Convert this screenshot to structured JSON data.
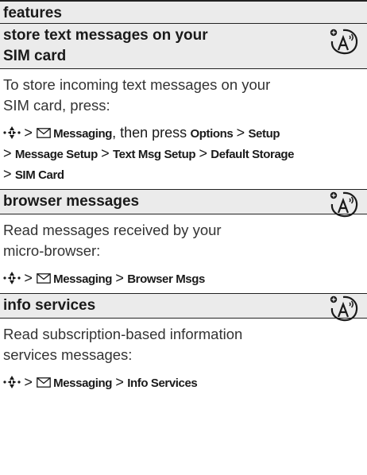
{
  "header": {
    "title": "features"
  },
  "sections": [
    {
      "title_line1": "store text messages on your",
      "title_line2": "SIM card",
      "icon": "network-operator-icon",
      "description_line1": "To store incoming text messages on your",
      "description_line2": "SIM card, press:",
      "path": {
        "messaging": "Messaging",
        "then_press": ", then press",
        "options": "Options",
        "setup": "Setup",
        "message_setup": "Message Setup",
        "text_msg_setup": "Text Msg Setup",
        "default_storage": "Default Storage",
        "sim_card": "SIM Card"
      }
    },
    {
      "title": "browser messages",
      "icon": "network-operator-icon",
      "description_line1": "Read messages received by your",
      "description_line2": "micro-browser:",
      "path": {
        "messaging": "Messaging",
        "browser_msgs": "Browser Msgs"
      }
    },
    {
      "title": "info services",
      "icon": "network-operator-icon",
      "description_line1": "Read subscription-based information",
      "description_line2": "services messages:",
      "path": {
        "messaging": "Messaging",
        "info_services": "Info Services"
      }
    }
  ],
  "separator": ">",
  "icons": {
    "nav_key": "nav-key-icon",
    "messaging": "envelope-icon"
  }
}
